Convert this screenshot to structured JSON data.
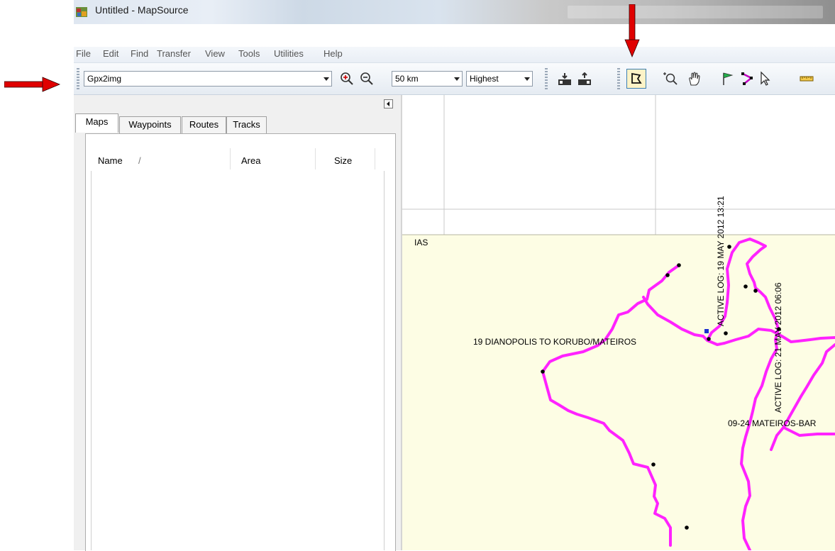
{
  "window": {
    "title": "Untitled - MapSource",
    "icon": "mapsource-app-icon"
  },
  "menu": [
    "File",
    "Edit",
    "Find",
    "Transfer",
    "View",
    "Tools",
    "Utilities",
    "Help"
  ],
  "toolbar": {
    "map_product": "Gpx2img",
    "zoom_scale": "50 km",
    "detail_level": "Highest",
    "icons": [
      "zoom-in-icon",
      "zoom-out-icon",
      "receive-from-device-icon",
      "send-to-device-icon",
      "map-select-tool-icon",
      "zoom-tool-icon",
      "hand-tool-icon",
      "waypoint-tool-icon",
      "route-tool-icon",
      "selection-tool-icon",
      "measure-tool-icon"
    ],
    "active_tool": "map-select-tool-icon"
  },
  "left_panel": {
    "tabs": [
      "Maps",
      "Waypoints",
      "Routes",
      "Tracks"
    ],
    "active_tab": "Maps",
    "columns": [
      "Name",
      "/",
      "Area",
      "Size"
    ]
  },
  "map": {
    "labels": {
      "ias": "IAS",
      "track19": "19 DIANOPOLIS TO KORUBO/MATEIROS",
      "track0924": "09-24 MATEIROS-BAR",
      "log1": "ACTIVE LOG: 19 MAY 2012 13:21",
      "log2": "ACTIVE LOG: 21 MAY 2012 06:06"
    },
    "colors": {
      "track": "#ff22ff",
      "land": "#fdfde4",
      "grid": "#c8c8c8"
    }
  },
  "annotations": {
    "arrow_color": "#e00000"
  }
}
